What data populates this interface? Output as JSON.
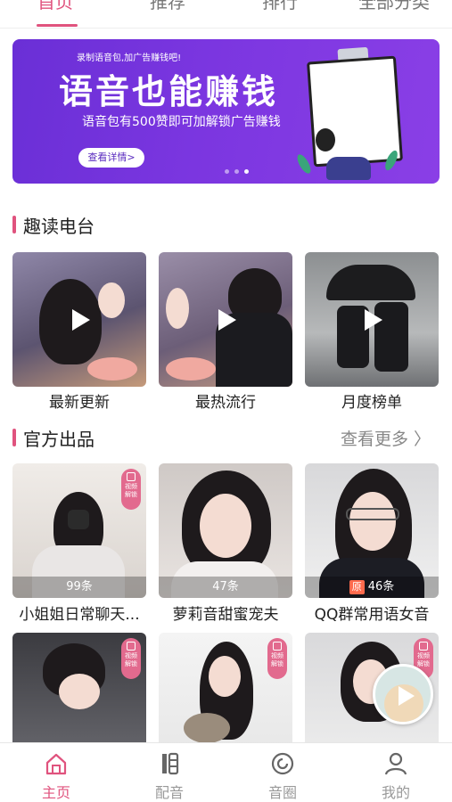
{
  "top_tabs": [
    {
      "label": "首页",
      "active": true
    },
    {
      "label": "推荐",
      "active": false
    },
    {
      "label": "排行",
      "active": false
    },
    {
      "label": "全部分类",
      "active": false
    }
  ],
  "banner": {
    "tag": "录制语音包,加广告赚钱吧!",
    "headline": "语音也能赚钱",
    "subline": "语音包有500赞即可加解锁广告赚钱",
    "detail_button": "查看详情>",
    "dots": 3,
    "active_dot": 2
  },
  "radio_section": {
    "title": "趣读电台",
    "items": [
      {
        "label": "最新更新",
        "icon": "play-icon"
      },
      {
        "label": "最热流行",
        "icon": "play-icon"
      },
      {
        "label": "月度榜单",
        "icon": "play-icon"
      }
    ]
  },
  "official_section": {
    "title": "官方出品",
    "more_label": "查看更多 〉",
    "items": [
      {
        "title": "小姐姐日常聊天...",
        "count": "99条",
        "badge": "视频解锁",
        "source_tag": ""
      },
      {
        "title": "萝莉音甜蜜宠夫",
        "count": "47条",
        "badge": "",
        "source_tag": ""
      },
      {
        "title": "QQ群常用语女音",
        "count": "46条",
        "badge": "",
        "source_tag": "原"
      },
      {
        "title": "",
        "count": "",
        "badge": "视频解锁",
        "source_tag": ""
      },
      {
        "title": "",
        "count": "",
        "badge": "视频解锁",
        "source_tag": ""
      },
      {
        "title": "",
        "count": "",
        "badge": "视频解锁",
        "source_tag": ""
      }
    ]
  },
  "badge_lines": [
    "视频",
    "解锁"
  ],
  "bottom_nav": [
    {
      "label": "主页",
      "icon": "home-icon",
      "active": true
    },
    {
      "label": "配音",
      "icon": "dubbing-icon",
      "active": false
    },
    {
      "label": "音圈",
      "icon": "audio-circle-icon",
      "active": false
    },
    {
      "label": "我的",
      "icon": "profile-icon",
      "active": false
    }
  ],
  "colors": {
    "accent": "#e0537e",
    "banner": "#6a2fd6"
  }
}
